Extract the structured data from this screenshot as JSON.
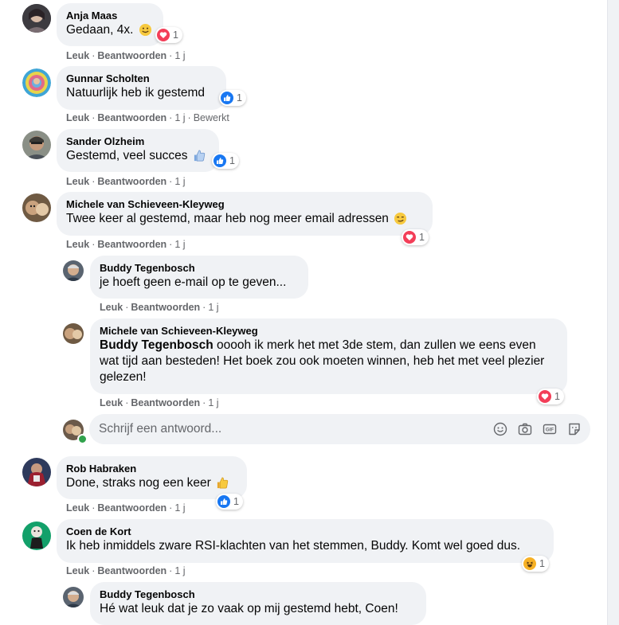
{
  "actions": {
    "like": "Leuk",
    "reply": "Beantwoorden",
    "edited": "Bewerkt"
  },
  "comments": [
    {
      "name": "Anja Maas",
      "text": "Gedaan, 4x.",
      "time": "1 j",
      "reactions": "1"
    },
    {
      "name": "Gunnar Scholten",
      "text": "Natuurlijk heb ik gestemd",
      "time": "1 j",
      "reactions": "1"
    },
    {
      "name": "Sander Olzheim",
      "text": "Gestemd, veel succes",
      "time": "1 j",
      "reactions": "1"
    },
    {
      "name": "Michele van Schieveen-Kleyweg",
      "text": "Twee keer al gestemd, maar heb nog meer email adressen",
      "time": "1 j",
      "reactions": "1"
    },
    {
      "name": "Buddy Tegenbosch",
      "text": "je hoeft geen e-mail op te geven...",
      "time": "1 j"
    },
    {
      "name": "Michele van Schieveen-Kleyweg",
      "mention": "Buddy Tegenbosch",
      "text": " ooooh ik merk het met 3de stem, dan zullen we eens even wat tijd aan besteden! Het boek zou ook moeten winnen, heb het met veel plezier gelezen!",
      "time": "1 j",
      "reactions": "1"
    },
    {
      "name": "Rob Habraken",
      "text": "Done, straks nog een keer",
      "time": "1 j",
      "reactions": "1"
    },
    {
      "name": "Coen de Kort",
      "text": "Ik heb inmiddels zware RSI-klachten van het stemmen, Buddy. Komt wel goed dus.",
      "time": "1 j",
      "reactions": "1"
    },
    {
      "name": "Buddy Tegenbosch",
      "text": "Hé wat leuk dat je zo vaak op mij gestemd hebt, Coen!"
    }
  ],
  "reply_box": {
    "placeholder": "Schrijf een antwoord..."
  },
  "icons": [
    "emoji-icon",
    "camera-icon",
    "gif-icon",
    "sticker-icon",
    "like-reaction-icon",
    "love-reaction-icon",
    "haha-reaction-icon"
  ],
  "colors": {
    "like": "#1877f2",
    "love": "#f33e58",
    "haha": "#f7b125",
    "bubble": "#f0f2f5",
    "meta": "#65676b"
  }
}
